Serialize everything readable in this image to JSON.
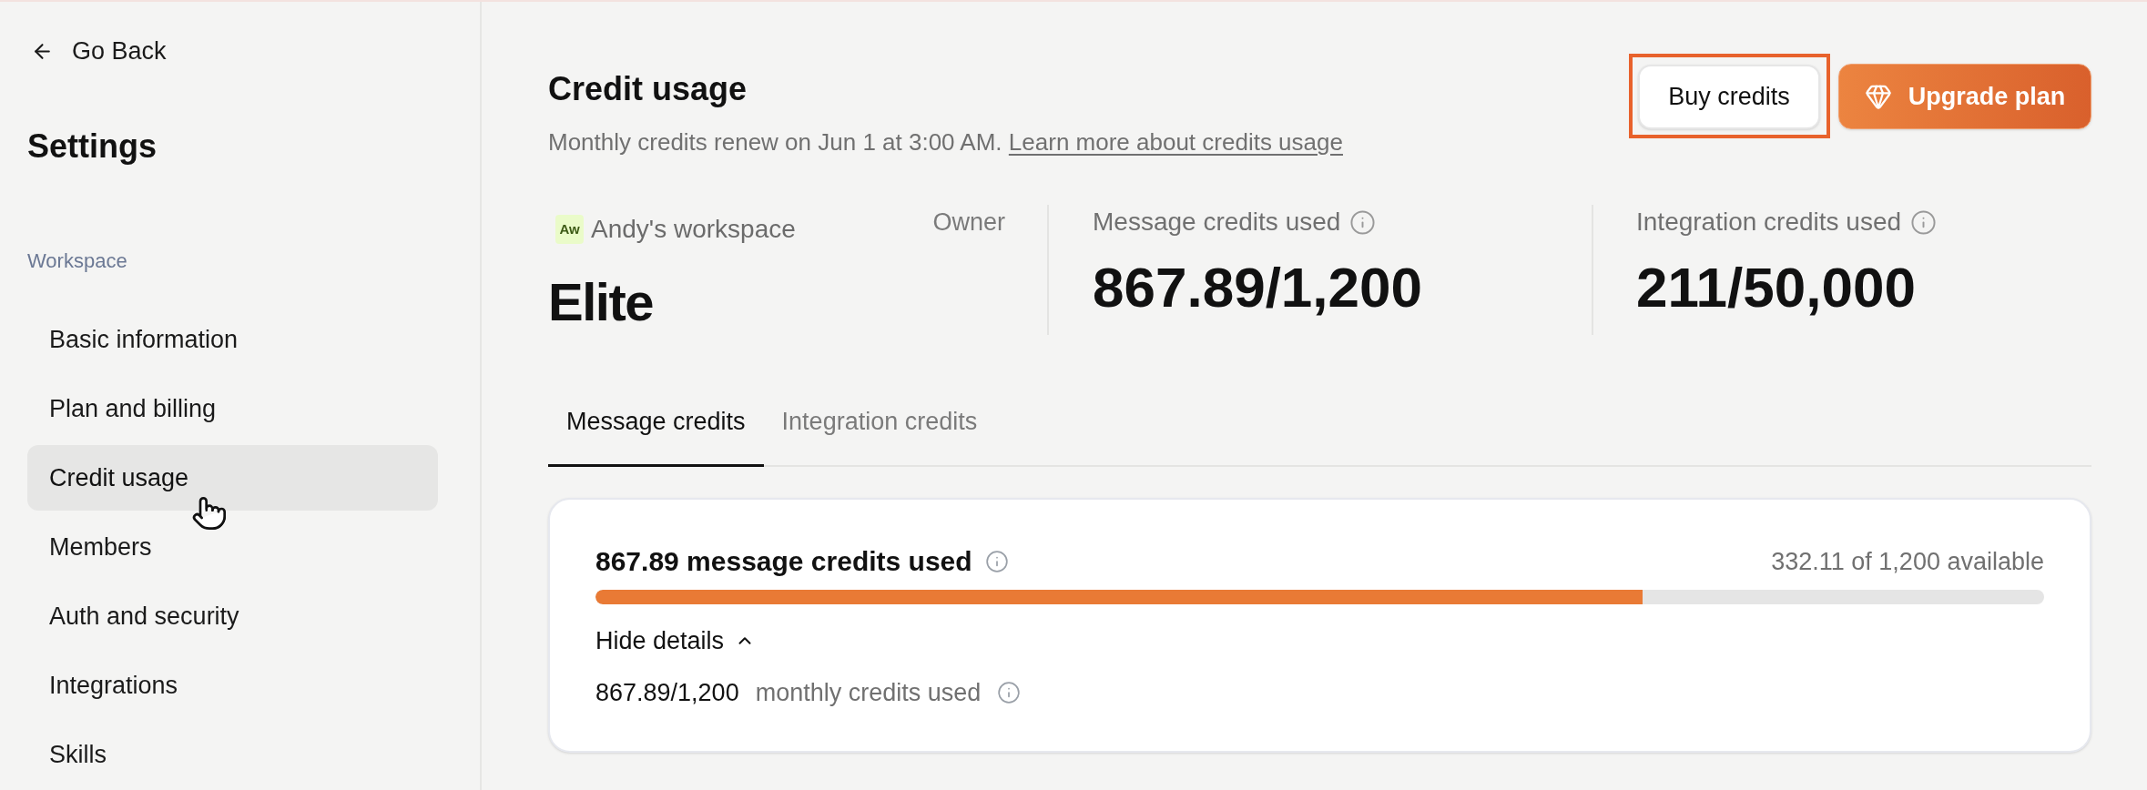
{
  "sidebar": {
    "back_link": "Go Back",
    "title": "Settings",
    "section": "Workspace",
    "items": [
      {
        "label": "Basic information",
        "selected": false
      },
      {
        "label": "Plan and billing",
        "selected": false
      },
      {
        "label": "Credit usage",
        "selected": true
      },
      {
        "label": "Members",
        "selected": false
      },
      {
        "label": "Auth and security",
        "selected": false
      },
      {
        "label": "Integrations",
        "selected": false
      },
      {
        "label": "Skills",
        "selected": false
      }
    ]
  },
  "header": {
    "title": "Credit usage",
    "subtitle": "Monthly credits renew on Jun 1 at 3:00 AM.",
    "link": "Learn more about credits usage",
    "buttons": [
      {
        "label": "Buy credits",
        "kind": "secondary",
        "highlighted": true
      },
      {
        "label": "Upgrade plan",
        "kind": "primary",
        "highlighted": false
      }
    ]
  },
  "workspace": {
    "avatar": "Aw",
    "name": "Andy's workspace",
    "role": "Owner",
    "plan": "Elite"
  },
  "stats": [
    {
      "label": "Message credits used",
      "value": "867.89/1,200"
    },
    {
      "label": "Integration credits used",
      "value": "211/50,000"
    }
  ],
  "tabs": [
    {
      "label": "Message credits",
      "selected": true
    },
    {
      "label": "Integration credits",
      "selected": false
    }
  ],
  "usage_card": {
    "title": "867.89 message credits used",
    "available": "332.11 of 1,200 available",
    "level": 0.723,
    "toggle": {
      "label": "Hide details",
      "expanded": true
    },
    "details": [
      {
        "value": "867.89/1,200",
        "label": "monthly credits used"
      }
    ]
  }
}
